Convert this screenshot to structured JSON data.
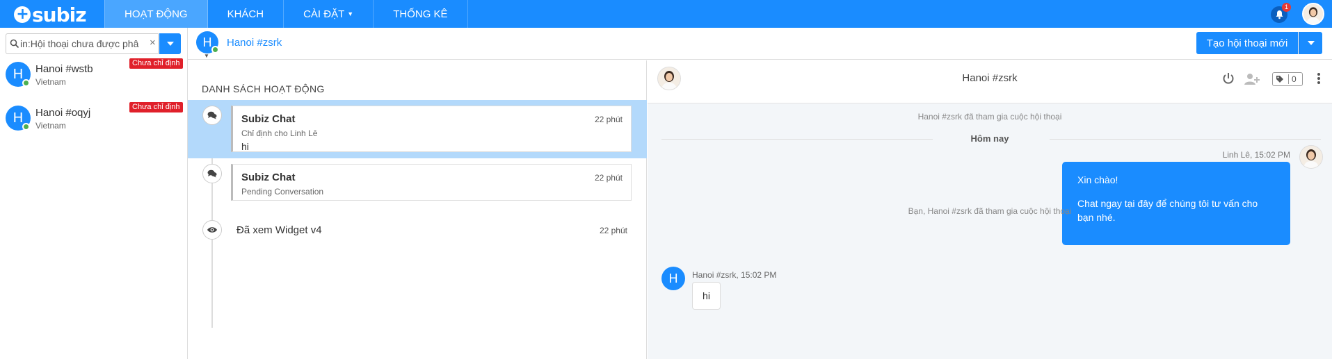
{
  "app": {
    "logo": "subiz",
    "accent": "#1a8cff"
  },
  "nav": {
    "items": [
      {
        "label": "HOẠT ĐỘNG",
        "active": true
      },
      {
        "label": "KHÁCH",
        "active": false
      },
      {
        "label": "CÀI ĐẶT",
        "active": false,
        "has_caret": true
      },
      {
        "label": "THỐNG KÊ",
        "active": false
      }
    ],
    "notification_count": "1",
    "icons": [
      "bell-icon",
      "user-avatar"
    ]
  },
  "sidebar": {
    "search": {
      "value": "in:Hội thoại chưa được phâ",
      "clear_symbol": "×"
    },
    "conversations": [
      {
        "avatar_letter": "H",
        "name": "Hanoi #wstb",
        "location": "Vietnam",
        "badge": "Chưa chỉ định",
        "online": true
      },
      {
        "avatar_letter": "H",
        "name": "Hanoi #oqyj",
        "location": "Vietnam",
        "badge": "Chưa chỉ định",
        "online": true
      }
    ]
  },
  "subheader": {
    "avatar_letter": "H",
    "visitor_name": "Hanoi #zsrk",
    "new_conversation_label": "Tạo hội thoại mới"
  },
  "activity": {
    "title": "DANH SÁCH HOẠT ĐỘNG",
    "items": [
      {
        "type": "chat",
        "title": "Subiz Chat",
        "subtitle": "Chỉ định cho Linh Lê",
        "message": "hi",
        "time": "22 phút",
        "selected": true,
        "icon": "chat-bubbles-icon"
      },
      {
        "type": "chat",
        "title": "Subiz Chat",
        "subtitle": "Pending Conversation",
        "message": "",
        "time": "22 phút",
        "selected": false,
        "icon": "chat-bubbles-icon"
      },
      {
        "type": "view",
        "title": "Đã xem Widget v4",
        "time": "22 phút",
        "icon": "eye-icon"
      }
    ]
  },
  "chat": {
    "header_name": "Hanoi #zsrk",
    "tag_count": "0",
    "header_icons": [
      "power-icon",
      "add-user-icon",
      "tag-icon",
      "more-vertical-icon"
    ],
    "system_join_1": "Hanoi #zsrk đã tham gia cuộc hội thoại",
    "day_label": "Hôm nay",
    "agent": {
      "meta": "Linh Lê, 15:02 PM",
      "lines": [
        "Xin chào!",
        "Chat ngay tại đây để chúng tôi tư vấn cho bạn nhé."
      ]
    },
    "system_join_2": "Bạn, Hanoi #zsrk đã tham gia cuộc hội thoại",
    "customer": {
      "avatar_letter": "H",
      "meta": "Hanoi #zsrk, 15:02 PM",
      "message": "hi"
    }
  }
}
